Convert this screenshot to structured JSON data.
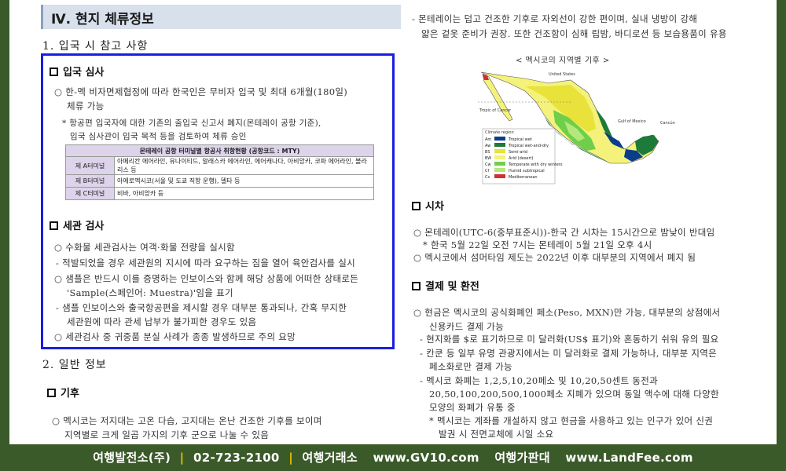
{
  "section_title": "Ⅳ. 현지 체류정보",
  "part1_title": "1. 입국 시 참고 사항",
  "immigration": {
    "heading": "입국 심사",
    "lines": [
      "○ 한-멕 비자면제협정에 따라 한국인은 무비자 입국 및 최대 6개월(180일)",
      "체류 가능",
      "* 항공편 입국자에 대한 기존의 출입국 신고서 폐지(몬테레이 공항 기준),",
      "입국 심사관이 입국 목적 등을 검토하여 체류 승인"
    ],
    "table": {
      "header": "몬테레이 공항 터미널별 항공사 취항현황 (공항코드 : MTY)",
      "rows": [
        {
          "terminal": "제 A터미널",
          "airlines": "아메리칸 에어라인, 유나이티드, 알래스카 에어라인, 에어캐나다, 아비앙카, 코파 에어라인, 볼라리스 등"
        },
        {
          "terminal": "제 B터미널",
          "airlines": "아에로멕시코(서울 및 도쿄 직항 운행), 델타 등"
        },
        {
          "terminal": "제 C터미널",
          "airlines": "비바, 아비앙카 등"
        }
      ]
    }
  },
  "customs": {
    "heading": "세관 검사",
    "lines": [
      "○ 수화물 세관검사는 여객·화물 전량을 실시함",
      "- 적발되었을 경우 세관원의 지시에 따라 요구하는 짐을 열어 육안검사를 실시",
      "○ 샘플은 반드시 이를 증명하는 인보이스와 함께 해당 상품에 어떠한 상태로든",
      "'Sample(스페인어: Muestra)'임을 표기",
      "- 샘플 인보이스와 출국항공편을 제시할 경우 대부분 통과되나, 간혹 무지한",
      "세관원에 따라 관세 납부가 불가피한 경우도 있음",
      "○ 세관검사 중 귀중품 분실 사례가 종종 발생하므로 주의 요망"
    ]
  },
  "part2_title": "2. 일반 정보",
  "climate": {
    "heading": "기후",
    "lines": [
      "○ 멕시코는 저지대는 고온 다습, 고지대는 온난 건조한 기후를 보이며",
      "지역별로 크게 일곱 가지의 기후 군으로 나눌 수 있음"
    ],
    "right_lines": [
      "- 몬테레이는 덥고 건조한 기후로 자외선이 강한 편이며, 실내 냉방이 강해",
      "얇은 겉옷 준비가 권장. 또한 건조함이 심해 립밤, 바디로션 등 보습용품이 유용"
    ],
    "map_title": "< 멕시코의 지역별 기후 >",
    "legend": [
      {
        "code": "Am",
        "label": "Tropical wet",
        "color": "#0a3d8a"
      },
      {
        "code": "Aw",
        "label": "Tropical wet-and-dry",
        "color": "#1e7a3a"
      },
      {
        "code": "BS",
        "label": "Semi-arid",
        "color": "#e8e23a"
      },
      {
        "code": "BW",
        "label": "Arid (desert)",
        "color": "#f4f27a"
      },
      {
        "code": "Cw",
        "label": "Temperate with dry winters",
        "color": "#6fcf4a"
      },
      {
        "code": "Cf",
        "label": "Humid subtropical",
        "color": "#b5e87a"
      },
      {
        "code": "Cs",
        "label": "Mediterranean",
        "color": "#d03030"
      }
    ],
    "map_labels": {
      "legend_title": "Climate region",
      "united_states": "United States",
      "tropic": "Tropic of Cancer",
      "gulf": "Gulf of Mexico",
      "cancun": "Cancún"
    }
  },
  "timezone": {
    "heading": "시차",
    "lines": [
      "○ 몬테레이(UTC-6(중부표준시))-한국 간 시차는 15시간으로 밤낮이 반대임",
      "* 한국 5월 22일 오전 7시는 몬테레이 5월 21일 오후 4시",
      "○ 멕시코에서 섬머타임 제도는 2022년 이후 대부분의 지역에서 폐지 됨"
    ]
  },
  "payment": {
    "heading": "결제 및 환전",
    "lines": [
      "○ 현금은 멕시코의 공식화폐인 페소(Peso, MXN)만 가능, 대부분의 상점에서",
      "신용카드 결제 가능",
      "- 현지화를 $로 표기하므로 미 달러화(US$ 표기)와 혼동하기 쉬워 유의 필요",
      "- 칸쿤 등 일부 유명 관광지에서는 미 달러화로 결제 가능하나, 대부분 지역은",
      "페소화로만 결제 가능",
      "- 멕시코 화폐는 1,2,5,10,20페소 및 10,20,50센트 동전과",
      "20,50,100,200,500,1000페소 지폐가 있으며 동일 액수에 대해 다양한",
      "모양의 화폐가 유통 중",
      "* 멕시코는 계좌를 개설하지 않고 현금을 사용하고 있는 인구가 있어 신권",
      "발권 시 전면교체에 시일 소요"
    ]
  },
  "footer": {
    "company": "여행발전소(주)",
    "phone": "02-723-2100",
    "exchange_label": "여행거래소",
    "exchange_url": "www.GV10.com",
    "price_label": "여행가판대",
    "price_url": "www.LandFee.com",
    "separator": "|"
  }
}
